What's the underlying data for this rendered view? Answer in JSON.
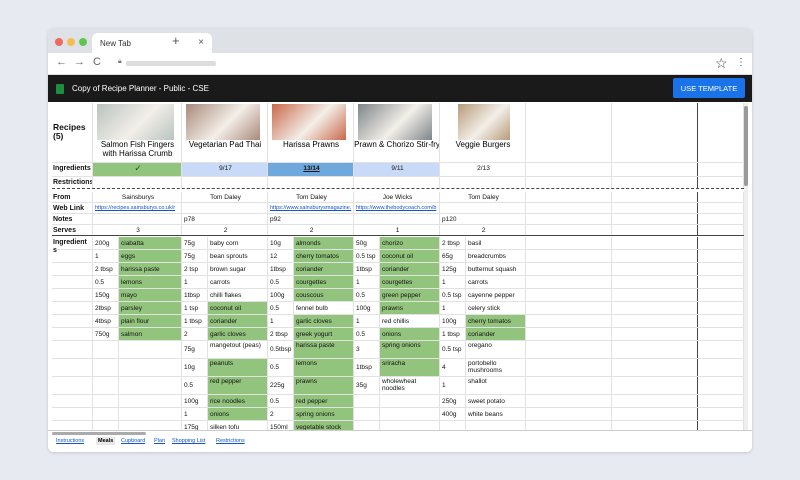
{
  "browser": {
    "tab_title": "New Tab",
    "tab_close": "×",
    "new_tab": "+",
    "back": "←",
    "forward": "→",
    "reload": "C",
    "star": "☆",
    "menu": "⋮"
  },
  "app": {
    "title": "Copy of Recipe Planner - Public - CSE",
    "use_template": "USE TEMPLATE"
  },
  "labels": {
    "recipes": "Recipes (5)",
    "ingredients_status": "Ingredients",
    "restrictions": "Restrictions",
    "from": "From",
    "web_link": "Web Link",
    "notes": "Notes",
    "serves": "Serves",
    "ingredients": "Ingredient s"
  },
  "recipes": [
    {
      "title": "Salmon Fish Fingers with Harissa Crumb",
      "status": "✓",
      "from": "Sainsburys",
      "link": "https://recipes.sainsburys.co.uk/r",
      "notes": "",
      "serves": "3",
      "photo_color": "#b9c3bf"
    },
    {
      "title": "Vegetarian Pad Thai",
      "status": "9/17",
      "from": "Tom Daley",
      "link": "",
      "notes": "p78",
      "serves": "2",
      "photo_color": "#a9897a"
    },
    {
      "title": "Harissa Prawns",
      "status": "13/14",
      "from": "Tom Daley",
      "link": "https://www.sainsburysmagazine.",
      "notes": "p92",
      "serves": "2",
      "photo_color": "#c9684a"
    },
    {
      "title": "Prawn & Chorizo Stir-fry",
      "status": "9/11",
      "from": "Joe Wicks",
      "link": "https://www.thebodycoach.com/b",
      "notes": "",
      "serves": "1",
      "photo_color": "#7d8588"
    },
    {
      "title": "Veggie Burgers",
      "status": "2/13",
      "from": "Tom Daley",
      "link": "",
      "notes": "p120",
      "serves": "2",
      "photo_color": "#b89a78"
    }
  ],
  "ingredients": [
    [
      [
        "200g",
        "ciabatta",
        1
      ],
      [
        "75g",
        "baby corn",
        0
      ],
      [
        "10g",
        "almonds",
        1
      ],
      [
        "50g",
        "chorizo",
        1
      ],
      [
        "2 tbsp",
        "basil",
        0
      ]
    ],
    [
      [
        "1",
        "eggs",
        1
      ],
      [
        "75g",
        "bean sprouts",
        0
      ],
      [
        "12",
        "cherry tomatos",
        1
      ],
      [
        "0.5 tsp",
        "coconut oil",
        1
      ],
      [
        "65g",
        "breadcrumbs",
        0
      ]
    ],
    [
      [
        "2 tbsp",
        "harissa paste",
        1
      ],
      [
        "2 tsp",
        "brown sugar",
        0
      ],
      [
        "1tbsp",
        "coriander",
        1
      ],
      [
        "1tbsp",
        "coriander",
        1
      ],
      [
        "125g",
        "butternut squash",
        0
      ]
    ],
    [
      [
        "0.5",
        "lemons",
        1
      ],
      [
        "1",
        "carrots",
        0
      ],
      [
        "0.5",
        "courgettes",
        1
      ],
      [
        "1",
        "courgettes",
        1
      ],
      [
        "1",
        "carrots",
        0
      ]
    ],
    [
      [
        "150g",
        "mayo",
        1
      ],
      [
        "1tbsp",
        "chilli flakes",
        0
      ],
      [
        "100g",
        "couscous",
        1
      ],
      [
        "0.5",
        "green pepper",
        1
      ],
      [
        "0.5 tsp",
        "cayenne pepper",
        0
      ]
    ],
    [
      [
        "2tbsp",
        "parsley",
        1
      ],
      [
        "1 tsp",
        "coconut oil",
        1
      ],
      [
        "0.5",
        "fennel bulb",
        0
      ],
      [
        "100g",
        "prawns",
        1
      ],
      [
        "1",
        "celery stick",
        0
      ]
    ],
    [
      [
        "4tbsp",
        "plain flour",
        1
      ],
      [
        "1 tbsp",
        "coriander",
        1
      ],
      [
        "1",
        "garlic cloves",
        1
      ],
      [
        "1",
        "red chillis",
        0
      ],
      [
        "100g",
        "cherry tomatos",
        1
      ]
    ],
    [
      [
        "750g",
        "salmon",
        1
      ],
      [
        "2",
        "garlic cloves",
        1
      ],
      [
        "2 tbsp",
        "greek yogurt",
        1
      ],
      [
        "0.5",
        "onions",
        1
      ],
      [
        "1 tbsp",
        "coriander",
        1
      ]
    ],
    [
      [
        "",
        "",
        0
      ],
      [
        "75g",
        "mangetout (peas)",
        0
      ],
      [
        "0.5tbsp",
        "harissa paste",
        1
      ],
      [
        "3",
        "spring onions",
        1
      ],
      [
        "0.5 tsp",
        "oregano",
        0
      ]
    ],
    [
      [
        "",
        "",
        0
      ],
      [
        "10g",
        "peanuts",
        1
      ],
      [
        "0.5",
        "lemons",
        1
      ],
      [
        "1tbsp",
        "sriracha",
        1
      ],
      [
        "4",
        "portobello mushrooms",
        0
      ]
    ],
    [
      [
        "",
        "",
        0
      ],
      [
        "0.5",
        "red pepper",
        1
      ],
      [
        "225g",
        "prawns",
        1
      ],
      [
        "35g",
        "wholewheat noodles",
        0
      ],
      [
        "1",
        "shallot",
        0
      ]
    ],
    [
      [
        "",
        "",
        0
      ],
      [
        "100g",
        "rice noodles",
        1
      ],
      [
        "0.5",
        "red pepper",
        1
      ],
      [
        "",
        "",
        0
      ],
      [
        "250g",
        "sweet potato",
        0
      ]
    ],
    [
      [
        "",
        "",
        0
      ],
      [
        "1",
        "onions",
        1
      ],
      [
        "2",
        "spring onions",
        1
      ],
      [
        "",
        "",
        0
      ],
      [
        "400g",
        "white beans",
        0
      ]
    ],
    [
      [
        "",
        "",
        0
      ],
      [
        "175g",
        "silken tofu",
        0
      ],
      [
        "150ml",
        "vegetable stock",
        1
      ],
      [
        "",
        "",
        0
      ],
      [
        "",
        "",
        0
      ]
    ]
  ],
  "sheet_tabs": [
    "Instructions",
    "Meals",
    "Cupboard",
    "Plan",
    "Shopping List",
    "Restrictions"
  ],
  "active_tab": "Meals",
  "colors": {
    "green": "#93c47d",
    "status_green": "#93c47d",
    "status_blue": "#c9daf8",
    "status_blue_dark": "#6fa8dc",
    "appbar": "#1a1a1a",
    "button": "#1a73e8"
  }
}
